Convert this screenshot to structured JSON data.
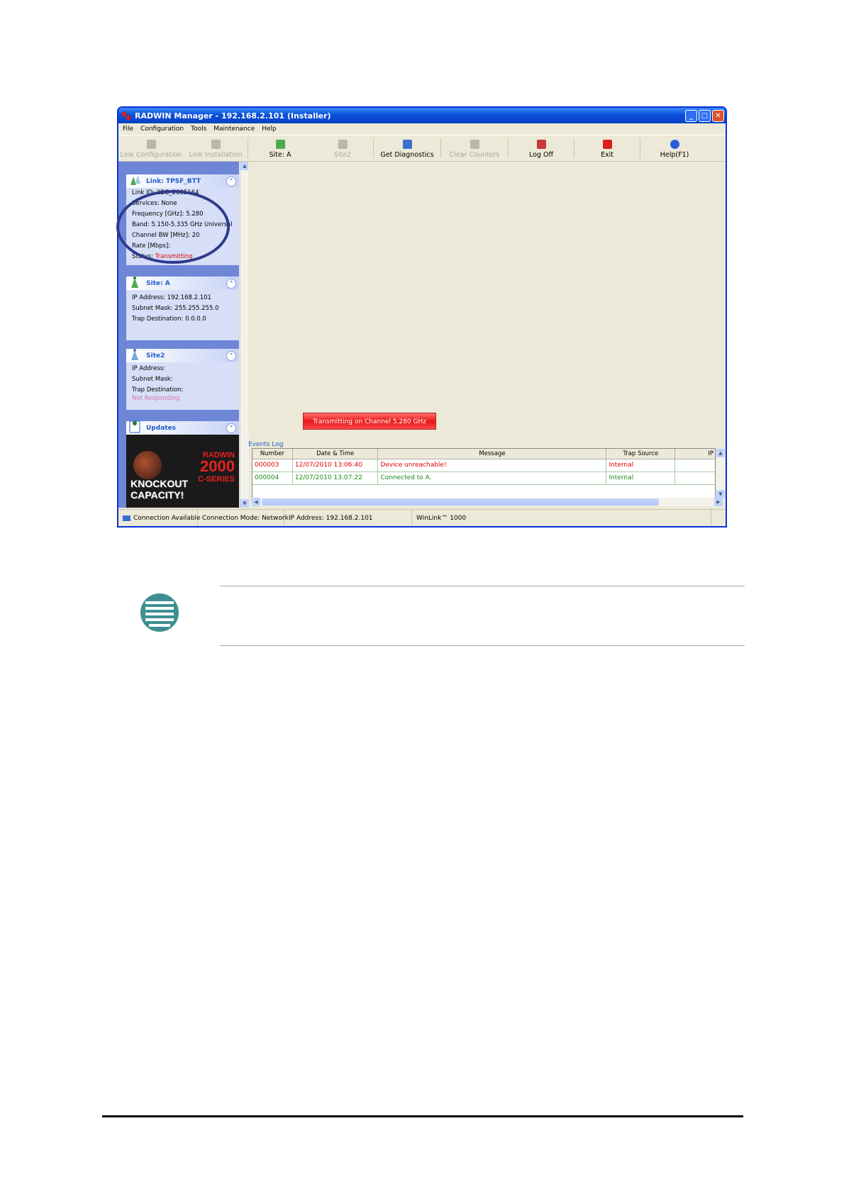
{
  "window": {
    "title": "RADWIN Manager - 192.168.2.101 (Installer)"
  },
  "menu": [
    "File",
    "Configuration",
    "Tools",
    "Maintenance",
    "Help"
  ],
  "toolbar": {
    "link_configuration": "Link Configuration",
    "link_installation": "Link Installation",
    "site_a": "Site: A",
    "site2": "Site2",
    "get_diagnostics": "Get Diagnostics",
    "clear_counters": "Clear Counters",
    "log_off": "Log Off",
    "exit": "Exit",
    "help": "Help(F1)"
  },
  "link_panel": {
    "title": "Link: TPSF_BTT",
    "link_id": "Link ID: ",
    "link_id_value": "2BG_2095164",
    "services": "Services: None",
    "frequency": "Frequency [GHz]: 5.280",
    "band": "Band: 5.150-5.335 GHz Universal",
    "channel_bw": "Channel BW [MHz]: 20",
    "rate": "Rate [Mbps]:",
    "status_label": "Status: ",
    "status_value": "Transmitting"
  },
  "site_a_panel": {
    "title": "Site: A",
    "ip": "IP Address: 192.168.2.101",
    "subnet": "Subnet Mask: 255.255.255.0",
    "trap": "Trap Destination: 0.0.0.0"
  },
  "site2_panel": {
    "title": "Site2",
    "ip": "IP Address:",
    "subnet": "Subnet Mask:",
    "trap": "Trap Destination:",
    "status": "Not Responding"
  },
  "updates_panel": {
    "title": "Updates",
    "ad_brand": "RADWIN",
    "ad_model": "2000",
    "ad_series": "C-SERIES",
    "ad_tagline": "KNOCKOUT CAPACITY!"
  },
  "banner": "Transmitting on Channel 5.280 GHz",
  "events_log": {
    "title": "Events Log",
    "columns": [
      "Number",
      "Date & Time",
      "Message",
      "Trap Source",
      "IP"
    ],
    "rows": [
      {
        "number": "000003",
        "datetime": "12/07/2010 13:06:40",
        "message": "Device unreachable!",
        "source": "Internal",
        "ip": ""
      },
      {
        "number": "000004",
        "datetime": "12/07/2010 13:07:22",
        "message": "Connected to A.",
        "source": "Internal",
        "ip": ""
      }
    ]
  },
  "statusbar": {
    "connection": "Connection Available",
    "mode": "Connection Mode: Network",
    "ip": "IP Address: 192.168.2.101",
    "product": "WinLink™ 1000"
  },
  "colors": {
    "title_blue": "#0a4fd8",
    "sidebar_blue": "#6e86d6",
    "error_red": "#e00000",
    "ok_green": "#1a8a1a",
    "annotation_oval": "#2e3a8c",
    "note_icon": "#3e8f91"
  }
}
